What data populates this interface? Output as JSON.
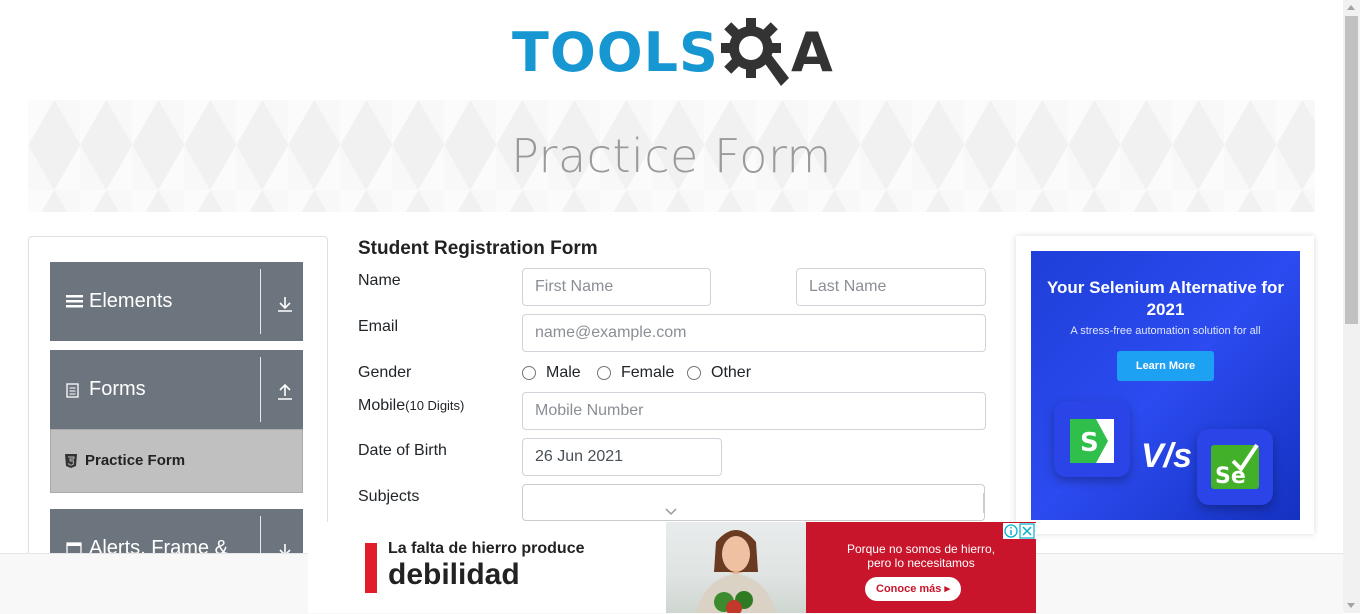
{
  "header": {
    "logo_tools": "TOOLS",
    "logo_a": "A",
    "page_title": "Practice Form",
    "logo_color": "#1797d2"
  },
  "sidebar": {
    "groups": [
      {
        "label": "Elements",
        "icon": "hamburger-icon",
        "arrow": "download-arrow-icon"
      },
      {
        "label": "Forms",
        "icon": "document-icon",
        "arrow": "upload-arrow-icon"
      },
      {
        "label": "Alerts, Frame &",
        "icon": "window-icon",
        "arrow": "download-arrow-icon"
      }
    ],
    "active_item": {
      "label": "Practice Form",
      "icon": "html5-icon"
    }
  },
  "form": {
    "title": "Student Registration Form",
    "name_label": "Name",
    "first_name_placeholder": "First Name",
    "last_name_placeholder": "Last Name",
    "email_label": "Email",
    "email_placeholder": "name@example.com",
    "gender_label": "Gender",
    "gender_options": [
      "Male",
      "Female",
      "Other"
    ],
    "mobile_label": "Mobile",
    "mobile_hint": "(10 Digits)",
    "mobile_placeholder": "Mobile Number",
    "dob_label": "Date of Birth",
    "dob_value": "26 Jun 2021",
    "subjects_label": "Subjects"
  },
  "ad_right": {
    "headline": "Your Selenium Alternative for 2021",
    "subtext": "A stress-free automation solution for all",
    "button": "Learn More",
    "vs": "V/s",
    "tile_left": "S",
    "tile_right": "Se",
    "bg_color": "#1e3fd8"
  },
  "ad_bottom": {
    "line1": "La falta de hierro produce",
    "line2": "debilidad",
    "red_text_1": "Porque no somos de hierro,",
    "red_text_2": "pero lo necesitamos",
    "cta": "Conoce más ▸"
  }
}
